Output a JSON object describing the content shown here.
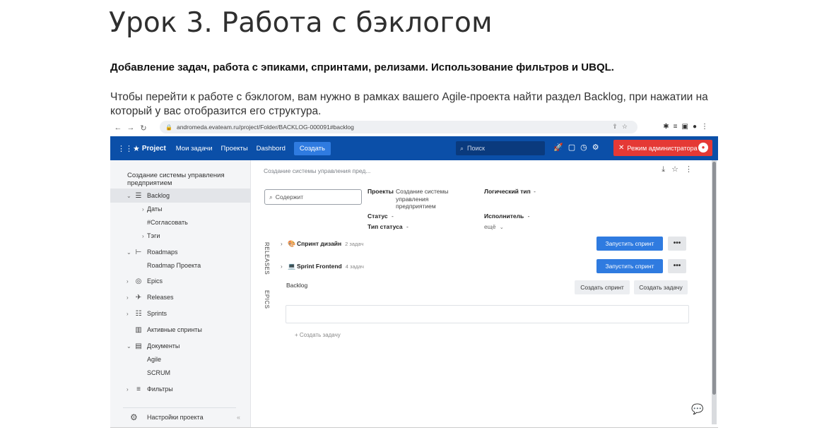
{
  "article": {
    "title": "Урок 3. Работа с бэклогом",
    "subtitle": "Добавление задач, работа с эпиками, спринтами, релизами. Использование фильтров и UBQL.",
    "paragraph": "Чтобы перейти к работе с бэклогом, вам нужно в рамках вашего Agile-проекта найти раздел Backlog, при нажатии на который у вас отобразится его структура."
  },
  "browser": {
    "url": "andromeda.evateam.ru/project/Folder/BACKLOG-000091#backlog"
  },
  "topbar": {
    "brand": "Project",
    "menu": [
      "Мои задачи",
      "Проекты",
      "Dashbord"
    ],
    "create_label": "Создать",
    "search_placeholder": "Поиск",
    "admin_label": "Режим администратора"
  },
  "sidebar": {
    "project_title": "Создание системы управления предприятием",
    "items": [
      {
        "label": "Backlog",
        "icon": "backlog-icon"
      },
      {
        "label": "Даты"
      },
      {
        "label": "#Согласовать"
      },
      {
        "label": "Тэги"
      },
      {
        "label": "Roadmaps",
        "icon": "roadmap-icon"
      },
      {
        "label": "Roadmap Проекта"
      },
      {
        "label": "Epics",
        "icon": "epics-icon"
      },
      {
        "label": "Releases",
        "icon": "releases-icon"
      },
      {
        "label": "Sprints",
        "icon": "sprints-icon"
      },
      {
        "label": "Активные спринты",
        "icon": "board-icon"
      },
      {
        "label": "Документы",
        "icon": "document-icon"
      },
      {
        "label": "Agile"
      },
      {
        "label": "SCRUM"
      },
      {
        "label": "Фильтры",
        "icon": "filter-icon"
      }
    ],
    "settings_label": "Настройки проекта"
  },
  "main": {
    "breadcrumb": "Создание системы управления пред...",
    "contains_placeholder": "Содержит",
    "projects_label": "Проекты",
    "projects_value": "Создание системы управления предприятием",
    "status_label": "Статус",
    "status_value": "-",
    "status_type_label": "Тип статуса",
    "status_type_value": "-",
    "logic_type_label": "Логический тип",
    "logic_type_value": "-",
    "assignee_label": "Исполнитель",
    "assignee_value": "-",
    "more_label": "ещё",
    "side_releases": "RELEASES",
    "side_epics": "EPICS",
    "sprints": [
      {
        "name": "Спринт дизайн",
        "count": "2 задач",
        "start_label": "Запустить спринт"
      },
      {
        "name": "Sprint Frontend",
        "count": "4 задач",
        "start_label": "Запустить спринт"
      }
    ],
    "backlog_label": "Backlog",
    "create_sprint_label": "Создать спринт",
    "create_task_label": "Создать задачу",
    "add_task_label": "+ Создать задачу",
    "more_dots": "•••"
  }
}
